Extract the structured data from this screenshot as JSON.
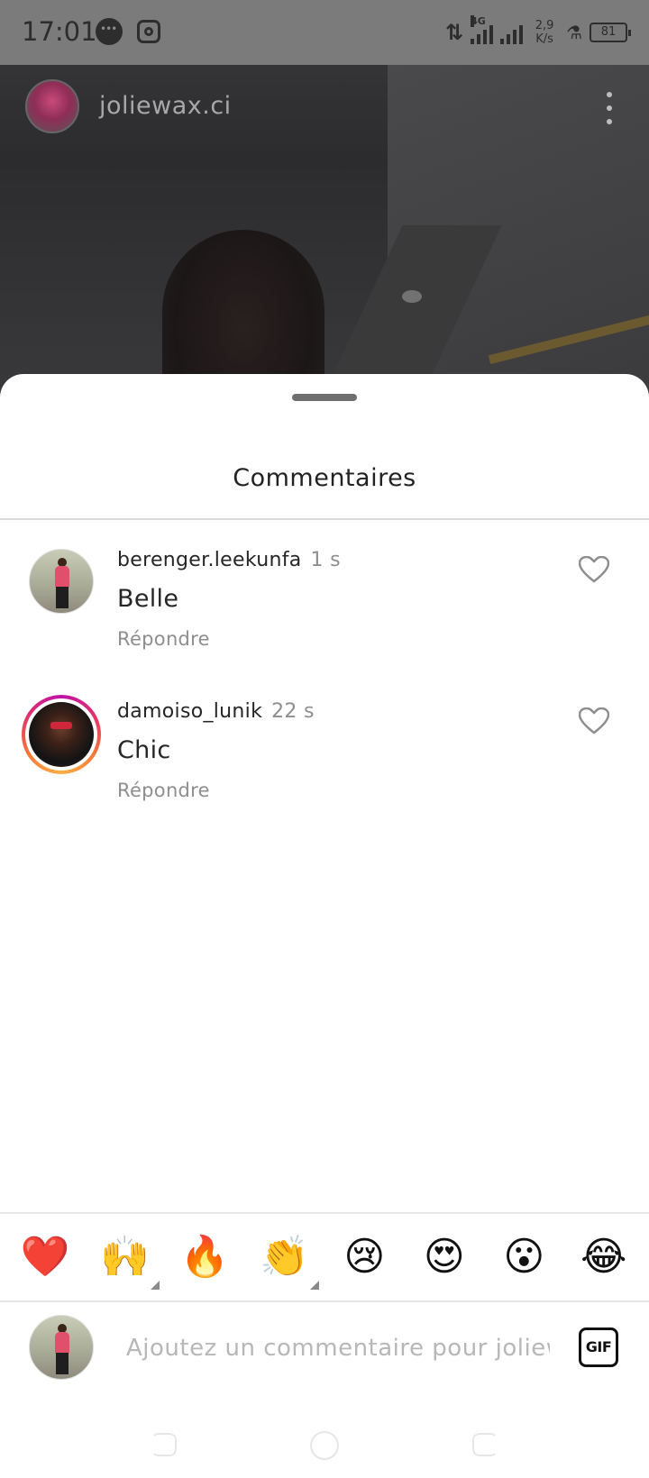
{
  "status_bar": {
    "time": "17:01",
    "network_type": "4G",
    "speed_value": "2,9",
    "speed_unit": "K/s",
    "battery": "81"
  },
  "live": {
    "host_username": "joliewax.ci"
  },
  "sheet": {
    "title": "Commentaires"
  },
  "comments": [
    {
      "username": "berenger.leekunfa",
      "time": "1 s",
      "text": "Belle",
      "reply_label": "Répondre",
      "has_story_ring": false
    },
    {
      "username": "damoiso_lunik",
      "time": "22 s",
      "text": "Chic",
      "reply_label": "Répondre",
      "has_story_ring": true
    }
  ],
  "emoji_bar": [
    {
      "name": "red-heart",
      "glyph": "❤️",
      "has_variants": false
    },
    {
      "name": "raising-hands",
      "glyph": "🙌",
      "has_variants": true
    },
    {
      "name": "fire",
      "glyph": "🔥",
      "has_variants": false
    },
    {
      "name": "clapping-hands",
      "glyph": "👏",
      "has_variants": true
    },
    {
      "name": "crying-face",
      "glyph": "😢",
      "has_variants": false
    },
    {
      "name": "heart-eyes",
      "glyph": "😍",
      "has_variants": false
    },
    {
      "name": "surprised-face",
      "glyph": "😮",
      "has_variants": false
    },
    {
      "name": "tears-of-joy",
      "glyph": "😂",
      "has_variants": false
    }
  ],
  "comment_input": {
    "placeholder": "Ajoutez un commentaire pour joliewax.ci...",
    "value": "",
    "gif_label": "GIF"
  },
  "colors": {
    "story_ring_start": "#c013a8",
    "story_ring_end": "#fcaf45",
    "secondary_text": "#8e8e8e"
  }
}
